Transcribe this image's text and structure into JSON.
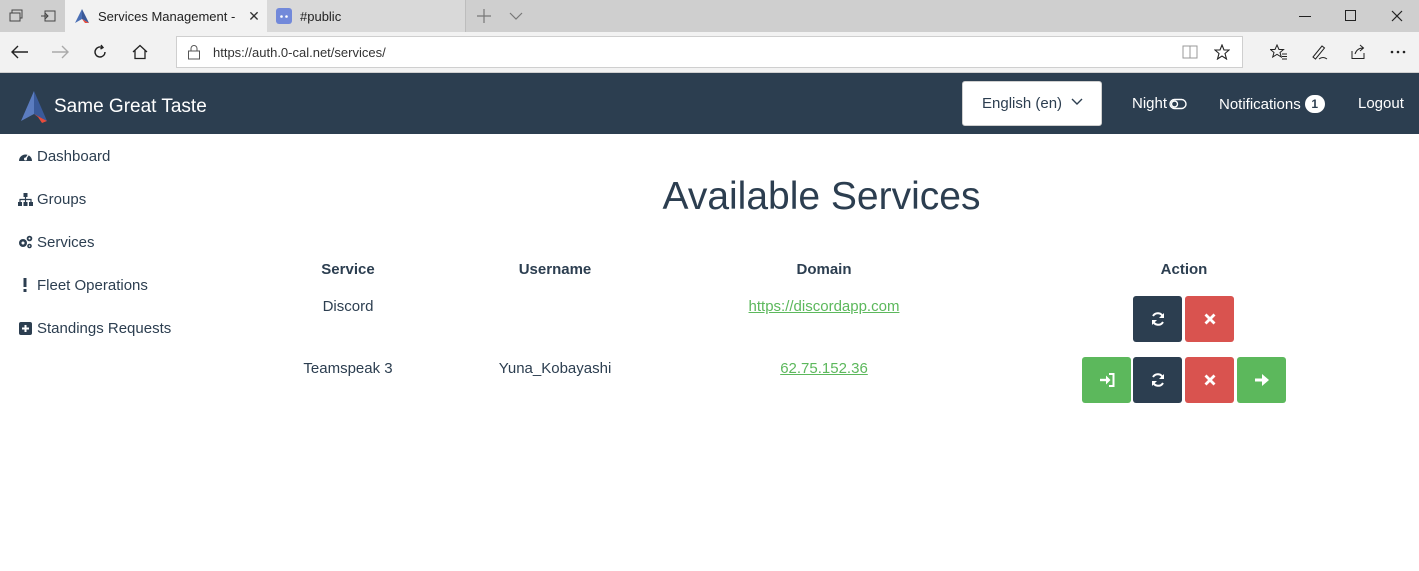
{
  "browser": {
    "tabs": [
      {
        "title": "Services Management -",
        "active": true
      },
      {
        "title": "#public",
        "active": false
      }
    ],
    "url": "https://auth.0-cal.net/services/"
  },
  "navbar": {
    "brand": "Same Great Taste",
    "language": "English (en)",
    "night_label": "Night",
    "notifications_label": "Notifications",
    "notifications_count": "1",
    "logout_label": "Logout",
    "colors": {
      "navbar_bg": "#2c3e50"
    }
  },
  "sidebar": {
    "items": [
      {
        "label": "Dashboard",
        "icon": "dashboard-icon"
      },
      {
        "label": "Groups",
        "icon": "sitemap-icon"
      },
      {
        "label": "Services",
        "icon": "cogs-icon"
      },
      {
        "label": "Fleet Operations",
        "icon": "exclamation-icon"
      },
      {
        "label": "Standings Requests",
        "icon": "plus-square-icon"
      }
    ]
  },
  "main": {
    "title": "Available Services",
    "columns": [
      "Service",
      "Username",
      "Domain",
      "Action"
    ],
    "rows": [
      {
        "service": "Discord",
        "username": "",
        "domain": "https://discordapp.com",
        "actions": [
          "refresh",
          "delete"
        ]
      },
      {
        "service": "Teamspeak 3",
        "username": "Yuna_Kobayashi",
        "domain": "62.75.152.36",
        "actions": [
          "sign-in",
          "refresh",
          "delete",
          "connect"
        ]
      }
    ],
    "colors": {
      "action_dark": "#2c3e50",
      "action_red": "#d9534f",
      "action_green": "#5cb85c",
      "link": "#5cb85c"
    }
  }
}
